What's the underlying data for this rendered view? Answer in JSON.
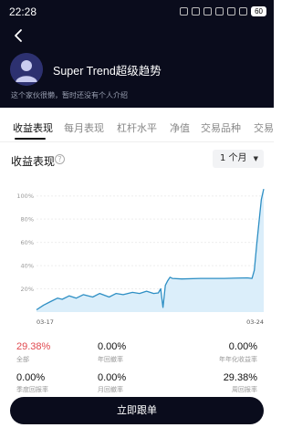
{
  "status_bar": {
    "time": "22:28",
    "battery": "60"
  },
  "profile": {
    "title": "Super Trend超级趋势",
    "subtitle": "这个家伙很懒，暂时还没有个人介绍"
  },
  "tabs": [
    "收益表现",
    "每月表现",
    "杠杆水平",
    "净值",
    "交易品种",
    "交易"
  ],
  "section": {
    "title": "收益表现",
    "period": "1 个月"
  },
  "chart_data": {
    "type": "area",
    "title": "",
    "xlabel": "",
    "ylabel": "",
    "x_tick_labels": [
      "03-17",
      "03-24"
    ],
    "y_tick_labels": [
      "20%",
      "40%",
      "60%",
      "80%",
      "100%"
    ],
    "ylim": [
      0,
      110
    ],
    "grid": true,
    "legend": "none",
    "line_color": "#2e8fc4",
    "fill_color": "#dbeefa",
    "series": [
      {
        "values": [
          [
            0,
            2
          ],
          [
            3,
            6
          ],
          [
            6,
            9
          ],
          [
            9,
            12
          ],
          [
            11,
            11
          ],
          [
            14,
            14
          ],
          [
            17,
            12
          ],
          [
            20,
            15
          ],
          [
            24,
            13
          ],
          [
            27,
            16
          ],
          [
            31,
            13
          ],
          [
            34,
            16
          ],
          [
            37,
            15
          ],
          [
            41,
            17
          ],
          [
            44,
            16
          ],
          [
            47,
            18
          ],
          [
            50,
            16
          ],
          [
            52,
            16.5
          ],
          [
            53,
            20
          ],
          [
            54,
            4
          ],
          [
            55,
            23
          ],
          [
            56,
            27
          ],
          [
            57,
            30
          ],
          [
            58,
            29
          ],
          [
            62,
            28.5
          ],
          [
            70,
            29
          ],
          [
            80,
            29
          ],
          [
            90,
            29.5
          ],
          [
            92,
            29
          ],
          [
            93,
            36
          ],
          [
            94,
            58
          ],
          [
            95,
            78
          ],
          [
            96,
            97
          ],
          [
            97,
            106
          ]
        ]
      }
    ]
  },
  "stats": [
    {
      "value": "29.38%",
      "label": "全部",
      "highlight": true
    },
    {
      "value": "0.00%",
      "label": "年回撤率"
    },
    {
      "value": "0.00%",
      "label": "年年化收益率"
    },
    {
      "value": "0.00%",
      "label": "季度回报率"
    },
    {
      "value": "0.00%",
      "label": "月回撤率"
    },
    {
      "value": "29.38%",
      "label": "周回报率"
    }
  ],
  "actions": {
    "follow_label": "立即跟单"
  }
}
